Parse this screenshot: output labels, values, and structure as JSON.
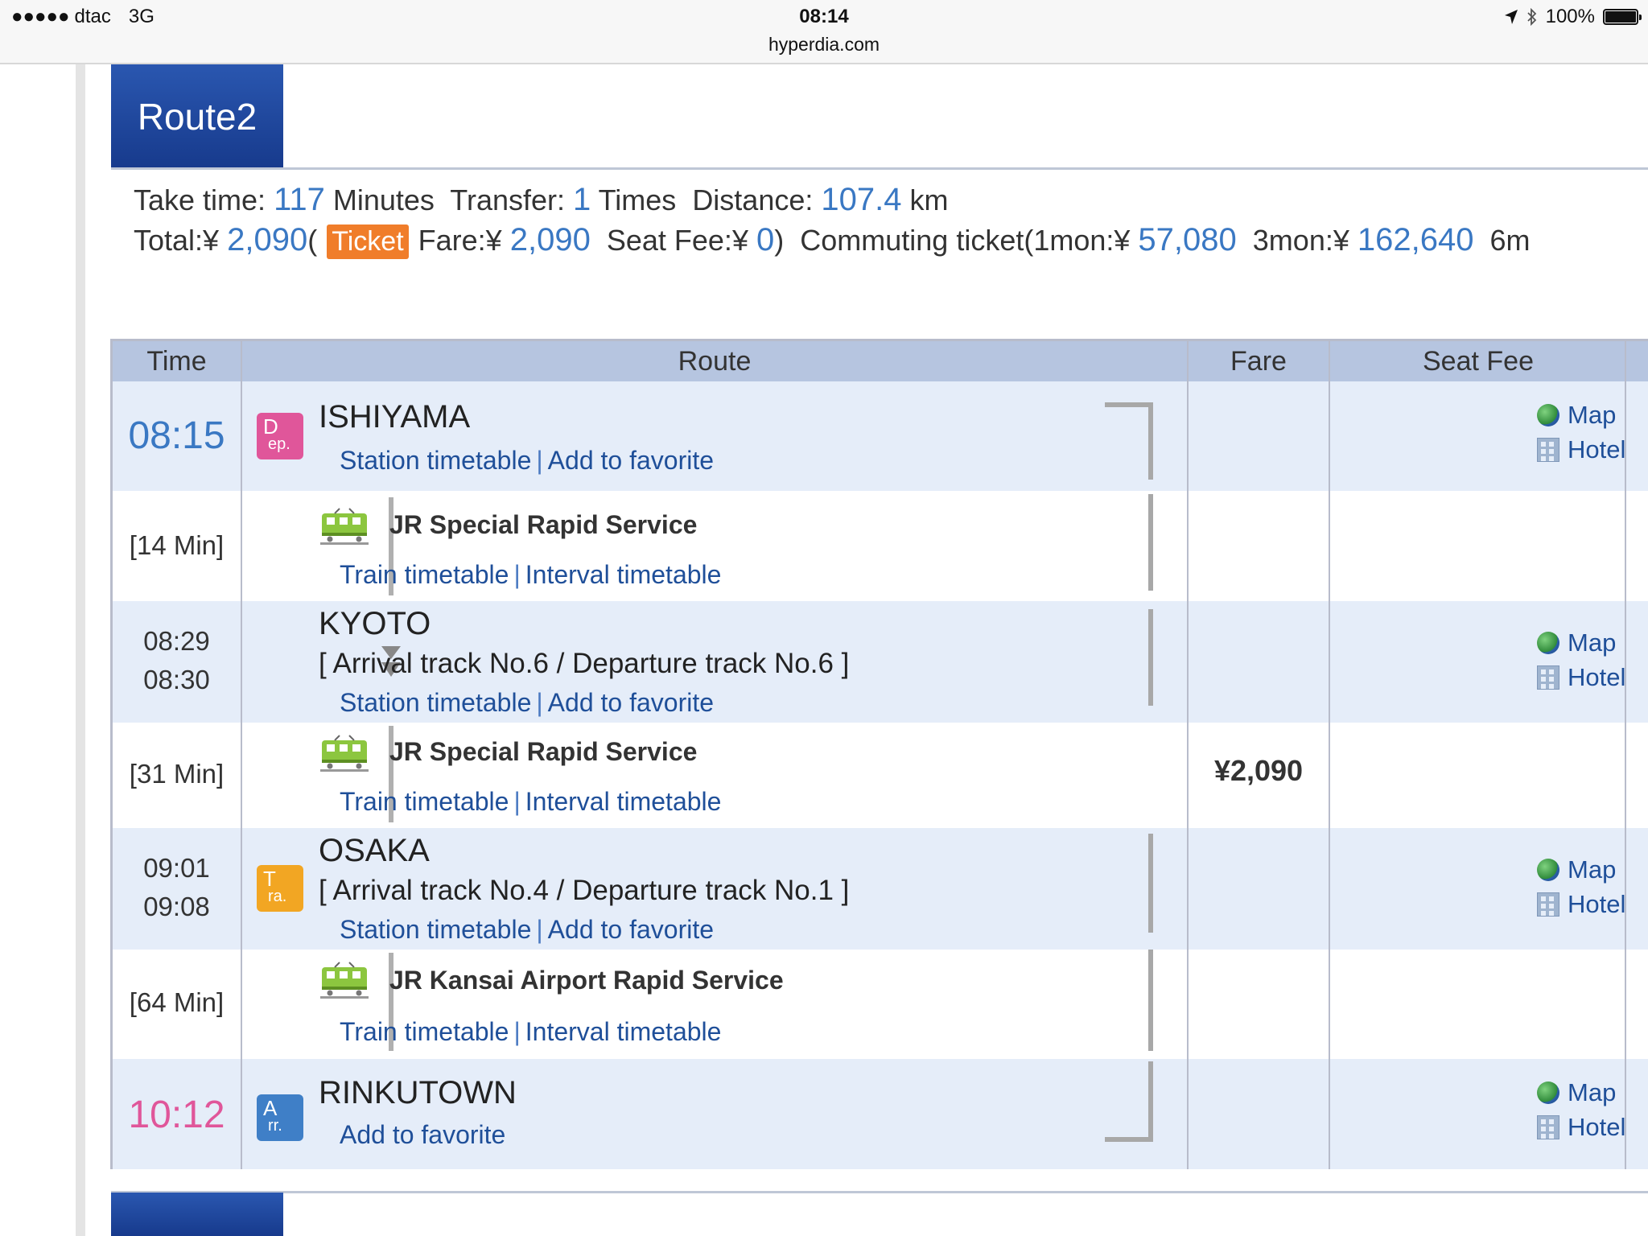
{
  "status_bar": {
    "signal": "●●●●●",
    "carrier": "dtac",
    "network": "3G",
    "time": "08:14",
    "url": "hyperdia.com",
    "battery": "100%",
    "battery_level": 1.0
  },
  "route": {
    "title": "Route2",
    "summary": {
      "take_time_label": "Take time:",
      "take_time_value": "117",
      "take_time_unit": "Minutes",
      "transfer_label": "Transfer:",
      "transfer_value": "1",
      "transfer_unit": "Times",
      "distance_label": "Distance:",
      "distance_value": "107.4",
      "distance_unit": "km",
      "total_label": "Total:¥",
      "total_value": "2,090",
      "open_paren": "(",
      "ticket_badge": "Ticket",
      "fare_label": "Fare:¥",
      "fare_value": "2,090",
      "seat_fee_label": "Seat Fee:¥",
      "seat_fee_value": "0",
      "close_paren": ")",
      "commuting_label": "Commuting ticket(1mon:¥",
      "commuting_1mon": "57,080",
      "commuting_3mon_label": "3mon:¥",
      "commuting_3mon": "162,640",
      "commuting_6mon_label": "6m"
    }
  },
  "table": {
    "headers": {
      "time": "Time",
      "route": "Route",
      "fare": "Fare",
      "seat_fee": "Seat Fee"
    },
    "links": {
      "station_timetable": "Station timetable",
      "add_to_favorite": "Add to favorite",
      "train_timetable": "Train timetable",
      "interval_timetable": "Interval timetable",
      "separator": "|",
      "map": "Map",
      "hotel": "Hotel"
    },
    "stops": [
      {
        "time": "08:15",
        "name": "ISHIYAMA",
        "badge_line1": "D",
        "badge_line2": "ep."
      },
      {
        "arrive": "08:29",
        "depart": "08:30",
        "name": "KYOTO",
        "track": "[ Arrival track No.6 / Departure track No.6 ]"
      },
      {
        "arrive": "09:01",
        "depart": "09:08",
        "name": "OSAKA",
        "track": "[ Arrival track No.4 / Departure track No.1 ]",
        "badge_line1": "T",
        "badge_line2": "ra."
      },
      {
        "time": "10:12",
        "name": "RINKUTOWN",
        "badge_line1": "A",
        "badge_line2": "rr."
      }
    ],
    "segments": [
      {
        "duration": "[14 Min]",
        "service": "JR Special Rapid Service"
      },
      {
        "duration": "[31 Min]",
        "service": "JR Special Rapid Service"
      },
      {
        "duration": "[64 Min]",
        "service": "JR Kansai Airport Rapid Service"
      }
    ],
    "fare_amount": "¥2,090"
  },
  "colors": {
    "route_tab": "#1f4a9e",
    "accent_blue": "#3a78c3",
    "accent_pink": "#e0569a",
    "ticket_orange": "#f07d2a",
    "station_row": "#e5edf9",
    "header_row": "#b6c5e0",
    "link": "#1f4f99"
  }
}
